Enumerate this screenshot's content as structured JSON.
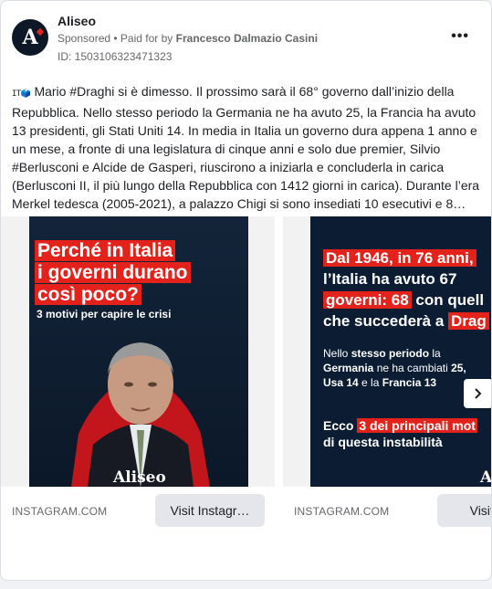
{
  "post": {
    "page_name": "Aliseo",
    "sponsored": "Sponsored",
    "separator": " • ",
    "paid_for_by": "Paid for by",
    "payer": "Francesco Dalmazio Casini",
    "ad_id": "ID: 1503106323471323",
    "more_icon": "more-horizontal-icon",
    "flag": "IT🗳️",
    "text": "Mario #Draghi si è dimesso. Il prossimo sarà il 68° governo dall’inizio della Repubblica. Nello stesso periodo la Germania ne ha avuto 25, la Francia ha avuto 13 presidenti, gli Stati Uniti 14. In media in Italia un governo dura appena 1 anno e un mese, a fronte di una legislatura di cinque anni e solo due premier, Silvio #Berlusconi e Alcide de Gasperi, riuscirono a iniziarla e concluderla in carica (Berlusconi II, il più lungo della Repubblica con 1412 giorni in carica). Durante l’era Merkel tedesca (2005-2021), a palazzo Chigi si sono insediati 10 esecutivi e 8…"
  },
  "avatar": {
    "letter": "A",
    "bg": "#0e1726",
    "accent": "#e1251b"
  },
  "carousel": {
    "slides": [
      {
        "headline": [
          "Perché in Italia",
          "i governi durano",
          "così poco?"
        ],
        "subheadline": "3 motivi per capire le crisi",
        "brand": "Aliseo",
        "caption": "INSTAGRAM.COM",
        "cta": "Visit Instagr…"
      },
      {
        "headline": [
          "Dal 1946, in 76 anni,",
          "l’Italia ha avuto 67",
          "governi: 68",
          " con quell",
          "che succederà a ",
          "Drag"
        ],
        "body_parts": [
          "Nello ",
          "stesso periodo",
          " la",
          "Germania",
          " ne ha cambiati ",
          "25,",
          "Usa 14",
          " e la ",
          "Francia 13"
        ],
        "lead_parts": [
          "Ecco ",
          "3 dei principali mot",
          "di questa instabilità"
        ],
        "brand": "A",
        "caption": "INSTAGRAM.COM",
        "cta": "Visit Ins"
      }
    ],
    "next_icon": "chevron-right-icon"
  },
  "colors": {
    "accent_red": "#e3231b",
    "poster_bg": "#0c1d33",
    "muted": "#65676b"
  }
}
